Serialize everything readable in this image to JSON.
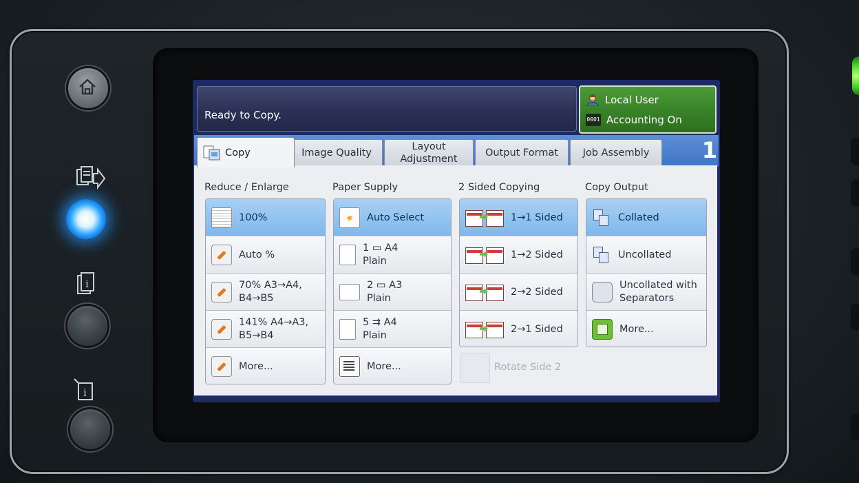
{
  "status": {
    "message": "Ready to Copy."
  },
  "user_panel": {
    "user": "Local User",
    "accounting": "Accounting On",
    "counter_icon_text": "0001"
  },
  "tabs": [
    {
      "label": "Copy",
      "active": true
    },
    {
      "label": "Image Quality"
    },
    {
      "label": "Layout Adjustment"
    },
    {
      "label": "Output Format"
    },
    {
      "label": "Job Assembly"
    }
  ],
  "page_number": "1",
  "reduce_enlarge": {
    "title": "Reduce / Enlarge",
    "options": [
      {
        "line1": "100%",
        "selected": true
      },
      {
        "line1": "Auto %"
      },
      {
        "line1": "70%  A3→A4,",
        "line2": "B4→B5"
      },
      {
        "line1": "141%  A4→A3,",
        "line2": "B5→B4"
      },
      {
        "line1": "More..."
      }
    ]
  },
  "paper_supply": {
    "title": "Paper Supply",
    "options": [
      {
        "line1": "Auto Select",
        "selected": true
      },
      {
        "line1": "1 ▭ A4",
        "line2": "Plain"
      },
      {
        "line1": "2 ▭ A3",
        "line2": "Plain"
      },
      {
        "line1": "5 ⇉ A4",
        "line2": "Plain"
      },
      {
        "line1": "More..."
      }
    ]
  },
  "two_sided": {
    "title": "2 Sided Copying",
    "options": [
      {
        "line1": "1→1 Sided",
        "selected": true
      },
      {
        "line1": "1→2 Sided"
      },
      {
        "line1": "2→2 Sided"
      },
      {
        "line1": "2→1 Sided"
      }
    ],
    "rotate_label": "Rotate Side 2"
  },
  "copy_output": {
    "title": "Copy Output",
    "options": [
      {
        "line1": "Collated",
        "selected": true
      },
      {
        "line1": "Uncollated"
      },
      {
        "line1": "Uncollated with",
        "line2": "Separators"
      },
      {
        "line1": "More..."
      }
    ]
  },
  "colors": {
    "accent_blue": "#7db8ec",
    "user_green": "#3a8428",
    "led_blue": "#2aa6ff"
  }
}
